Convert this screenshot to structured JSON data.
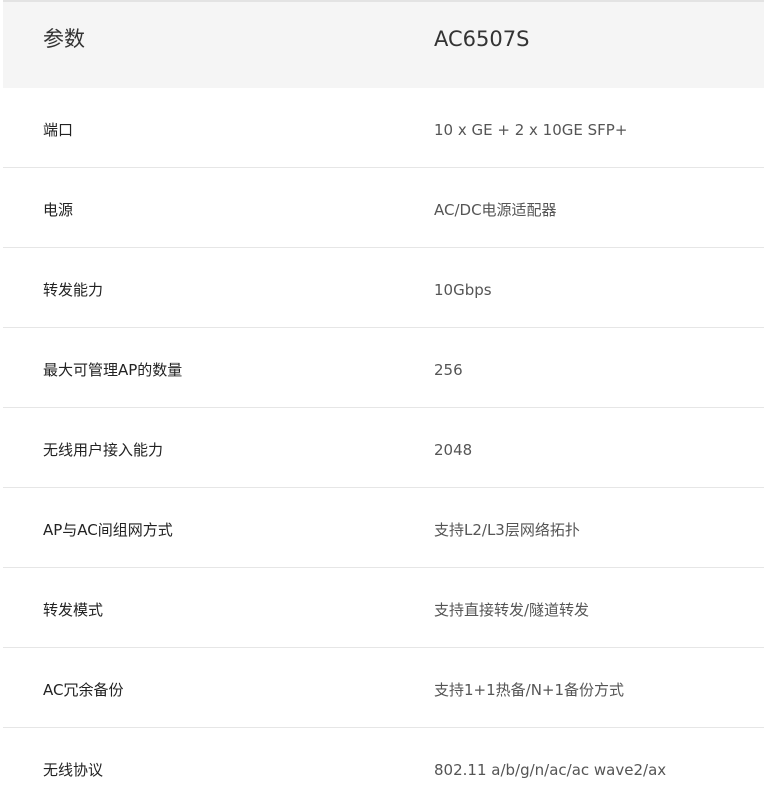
{
  "header": {
    "param_label": "参数",
    "value_label": "AC6507S"
  },
  "rows": [
    {
      "param": "端口",
      "value": "10 x GE + 2 x 10GE SFP+"
    },
    {
      "param": "电源",
      "value": "AC/DC电源适配器"
    },
    {
      "param": "转发能力",
      "value": "10Gbps"
    },
    {
      "param": "最大可管理AP的数量",
      "value": "256"
    },
    {
      "param": "无线用户接入能力",
      "value": "2048"
    },
    {
      "param": "AP与AC间组网方式",
      "value": "支持L2/L3层网络拓扑"
    },
    {
      "param": "转发模式",
      "value": "支持直接转发/隧道转发"
    },
    {
      "param": "AC冗余备份",
      "value": "支持1+1热备/N+1备份方式"
    },
    {
      "param": "无线协议",
      "value": "802.11 a/b/g/n/ac/ac wave2/ax"
    }
  ]
}
